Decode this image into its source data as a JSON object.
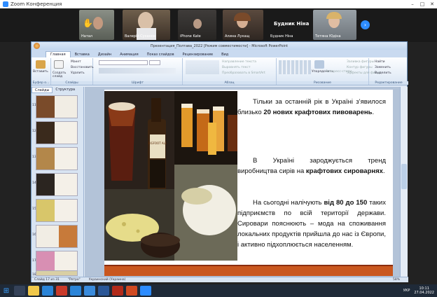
{
  "zoom": {
    "title": "Zoom Конференция",
    "participants": [
      "Натал",
      "Валерій Суханов",
      "iPhone Kate",
      "Алина Лукащ",
      "Будник Ніна",
      "Тетяна Юдіна"
    ],
    "big_name": "Будник Ніна"
  },
  "ppt": {
    "title": "Презентация_Полтава_2022 [Режим совместимости] - Microsoft PowerPoint",
    "tabs": [
      "Главная",
      "Вставка",
      "Дизайн",
      "Анимация",
      "Показ слайдов",
      "Рецензирование",
      "Вид"
    ],
    "groups": [
      "Буфер о...",
      "Слайды",
      "Шрифт",
      "Абзац",
      "Рисование",
      "Редактирование"
    ],
    "ribbon": {
      "paste": "Вставить",
      "create": "Создать слайд",
      "layout": "Макет",
      "reset": "Восстановить",
      "delete": "Удалить",
      "direction": "Направление текста",
      "align": "Выровнять текст",
      "smartart": "Преобразовать в SmartArt",
      "arrange": "Упорядочить",
      "quick": "Экспресс-стили",
      "fill": "Заливка фигуры",
      "outline": "Контур фигуры",
      "effects": "Эффекты для фигур",
      "find": "Найти",
      "replace": "Заменить",
      "select": "Выделить"
    },
    "panel_tabs": [
      "Слайды",
      "Структура"
    ],
    "thumb_numbers": [
      "11",
      "12",
      "13",
      "14",
      "15",
      "16",
      "17",
      "18"
    ],
    "status": {
      "slide": "Слайд 17 из 31",
      "theme": "\"Ретро\"",
      "lang": "Украинский (Украина)",
      "zoom": "58%"
    }
  },
  "slide": {
    "p1a": "Тільки за останній рік в Україні з’явилося близько ",
    "p1b": "20 нових крафтових пивоварень",
    "p2a": "В Україні зароджується тренд виробництва сирів на ",
    "p2b": "крафтових сироварнях",
    "p3a": "На сьогодні налічують ",
    "p3b": "від 80 до 150",
    "p3c": " таких підприємств по всій території держави. Сировари пояснюють – мода на споживання локальних продуктів прийшла до нас із Європи, і активно підхоплюється населенням.",
    "bottle_label": "BIGFOOT ALE"
  },
  "taskbar": {
    "lang": "УКР",
    "time": "10:11",
    "date": "27.04.2022"
  }
}
